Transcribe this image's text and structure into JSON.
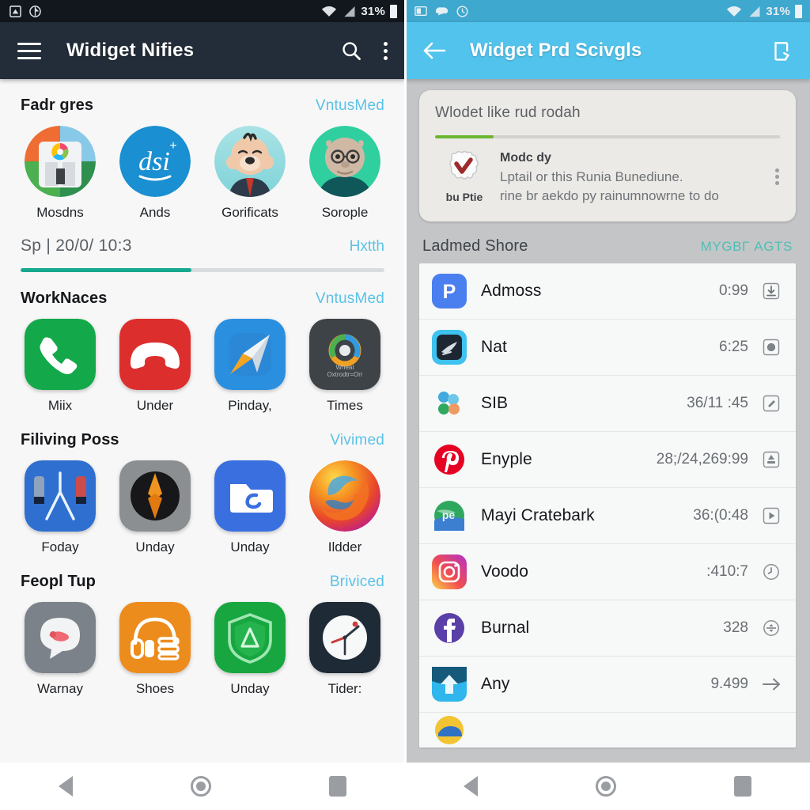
{
  "left": {
    "statusbar": {
      "battery_percent": "31%",
      "icons": [
        "sim-icon",
        "nav-icon",
        "wifi-icon",
        "signal-icon",
        "battery-icon"
      ]
    },
    "appbar": {
      "title": "Widiget Nifies",
      "menu_icon": "hamburger-icon",
      "search_icon": "search-icon",
      "overflow_icon": "kebab-icon"
    },
    "sections": [
      {
        "title": "Fadr gres",
        "action": "VntusMed",
        "items": [
          {
            "label": "Mosdns",
            "icon": "photos-circle-icon"
          },
          {
            "label": "Ands",
            "icon": "dsi-circle-icon"
          },
          {
            "label": "Gorificats",
            "icon": "avatar-bear-icon"
          },
          {
            "label": "Sorople",
            "icon": "avatar-ogre-icon"
          }
        ]
      },
      {
        "title": "WorkNaces",
        "action": "VntusMed",
        "items": [
          {
            "label": "Miix",
            "icon": "phone-icon"
          },
          {
            "label": "Under",
            "icon": "endcall-icon"
          },
          {
            "label": "Pinday,",
            "icon": "paperplane-icon"
          },
          {
            "label": "Times",
            "icon": "browser-icon"
          }
        ]
      },
      {
        "title": "Filiving Poss",
        "action": "Vivimed",
        "items": [
          {
            "label": "Foday",
            "icon": "thermometer-icon"
          },
          {
            "label": "Unday",
            "icon": "compass-icon"
          },
          {
            "label": "Unday",
            "icon": "folder-icon"
          },
          {
            "label": "Ildder",
            "icon": "firefox-icon"
          }
        ]
      },
      {
        "title": "Feopl Tup",
        "action": "Briviced",
        "items": [
          {
            "label": "Warnay",
            "icon": "chat-bubble-icon"
          },
          {
            "label": "Shoes",
            "icon": "headphones-icon"
          },
          {
            "label": "Unday",
            "icon": "shield-icon"
          },
          {
            "label": "Tider:",
            "icon": "clock-icon"
          }
        ]
      }
    ],
    "progress": {
      "label": "Sp | 20/0/ 10:3",
      "action": "Hxtth",
      "percent": 47,
      "fill_color": "#17a98e"
    }
  },
  "right": {
    "statusbar": {
      "battery_percent": "31%",
      "icons": [
        "cast-icon",
        "chat-icon",
        "clock-icon",
        "wifi-icon",
        "signal-icon",
        "battery-icon"
      ]
    },
    "appbar": {
      "title": "Widget Prd Scivgls",
      "back_icon": "arrow-back-icon",
      "action_icon": "rotate-device-icon"
    },
    "promo_card": {
      "title": "Wlodet like rud rodah",
      "progress_percent": 17,
      "progress_color": "#6bb731",
      "badge_name": "bu Ptie",
      "badge_icon": "check-badge-icon",
      "heading": "Modc dy",
      "line1": "Lptail or this Runia Bunediune.",
      "line2": "rine br aekdo py rainumnowrne to do",
      "overflow_icon": "kebab-icon"
    },
    "list_header": {
      "title": "Ladmed Shore",
      "action": "MYGBΓ AGTS",
      "action_color": "#4fbfb5"
    },
    "rows": [
      {
        "name": "Admoss",
        "value": "0:99",
        "icon": "play-store-icon",
        "action_icon": "download-icon"
      },
      {
        "name": "Nat",
        "value": "6:25",
        "icon": "plane-icon",
        "action_icon": "record-icon"
      },
      {
        "name": "SIB",
        "value": "36/11 :45",
        "icon": "slack-icon",
        "action_icon": "edit-icon"
      },
      {
        "name": "Enyple",
        "value": "28;/24,269:99",
        "icon": "pinterest-icon",
        "action_icon": "upload-icon"
      },
      {
        "name": "Mayi Cratebark",
        "value": "36:\u0001(0:48",
        "icon": "maps-icon",
        "action_icon": "play-icon"
      },
      {
        "name": "Voodo",
        "value": ":410:7",
        "icon": "instagram-icon",
        "action_icon": "history-icon"
      },
      {
        "name": "Burnal",
        "value": "328",
        "icon": "facebook-icon",
        "action_icon": "sync-icon"
      },
      {
        "name": "Any",
        "value": "9.499",
        "icon": "upload-app-icon",
        "action_icon": "arrow-right-icon"
      }
    ]
  },
  "navbar": {
    "back": "back-icon",
    "home": "home-icon",
    "recent": "recents-icon"
  }
}
